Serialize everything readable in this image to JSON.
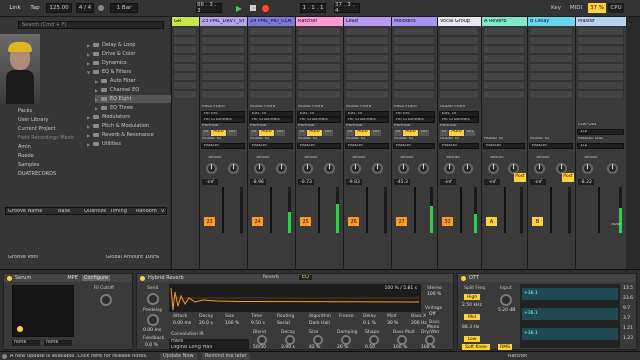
{
  "colors": {
    "accent": "#ff9a1f",
    "meter": "#30d048",
    "yellow": "#ffd23a"
  },
  "topbar": {
    "link": "Link",
    "tap": "Tap",
    "tempo": "125.00",
    "meter_sig": "4 / 4",
    "metro": "1 Bar",
    "position": "1 . 1 . 1",
    "loop_start": "86 . 3 . 3",
    "loop_len": "37 . 3 . 4",
    "key": "Key",
    "midi": "MIDI",
    "cpu_pct": "37 %",
    "cpu": "CPU"
  },
  "browser": {
    "search_placeholder": "Search (Cmd + F)",
    "places": [
      "Packs",
      "User Library",
      "Current Project",
      "Field Recordings Mastr",
      "Amin",
      "Ruede",
      "Samples",
      "DUATRECORDS",
      "Groove Pool"
    ],
    "tree": [
      "Delay & Loop",
      "Drive & Color",
      "Dynamics",
      "EQ & Filters",
      "Auto Filter",
      "Channel EQ",
      "EQ Eight",
      "EQ Three",
      "Modulators",
      "Pitch & Modulation",
      "Reverb & Resonance",
      "Utilities"
    ],
    "groove_cols": [
      "Groove Name",
      "Base",
      "Quantize",
      "Timing",
      "Random",
      "V"
    ],
    "global_amount_label": "Global Amount",
    "global_amount": "100%"
  },
  "tracks": [
    {
      "name": "GR",
      "color": "#c8e64a",
      "num": "",
      "vol": ""
    },
    {
      "name": "23 PML_DRV7_SY",
      "color": "#b6a4e6",
      "num": "23",
      "vol": "-inf"
    },
    {
      "name": "24 PML_MD_CLA",
      "color": "#7b78dc",
      "num": "24",
      "vol": "-8.96"
    },
    {
      "name": "Ratchet",
      "color": "#ff9ad4",
      "num": "25",
      "vol": "-0.73"
    },
    {
      "name": "Lead",
      "color": "#b89af0",
      "num": "26",
      "vol": "-9.83"
    },
    {
      "name": "Melodics",
      "color": "#a993f0",
      "num": "27",
      "vol": "-45.3"
    },
    {
      "name": "Vocal Group",
      "color": "#e7e7f3",
      "num": "32",
      "vol": "-inf"
    },
    {
      "name": "A Reverb",
      "color": "#7ee8c8",
      "num": "A",
      "vol": "-inf"
    },
    {
      "name": "B Delay",
      "color": "#67d7ee",
      "num": "B",
      "vol": "-inf"
    },
    {
      "name": "Master",
      "color": "#b9d3ee",
      "num": "",
      "vol": "-8.22"
    }
  ],
  "io": {
    "midi_from": "MIDI From",
    "audio_from": "Audio From",
    "all_ins": "All Ins",
    "ext_in": "Ext. In",
    "all_channels": "All Channels",
    "monitor": "Monitor",
    "in": "In",
    "auto": "Auto",
    "off": "Off",
    "audio_to": "Audio To",
    "master": "Master",
    "sends": "Sends",
    "cue_out": "Cue Out",
    "cue_val": "1/2",
    "master_out": "Master Out",
    "master_val": "1/2",
    "post": "Post",
    "solo": "Solo"
  },
  "devices": {
    "serum": {
      "title": "Serum",
      "mpe": "MPE",
      "configure": "Configure",
      "fil_cutoff": "Fil Cutoff",
      "none": "none"
    },
    "reverb": {
      "title": "Hybrid Reverb",
      "reverb_tab": "Reverb",
      "eq_tab": "EQ",
      "send": "Send",
      "predelay": "Predelay",
      "predelay_val": "0.00 ms",
      "feedback": "Feedback",
      "feedback_val": "0.0 %",
      "env_labels": [
        "Attack",
        "Decay",
        "Size",
        "Time",
        "Routing",
        "Algorithm",
        "Freeze",
        "Delay",
        "Mod",
        "Bass X"
      ],
      "env_vals": [
        "0.00 ms",
        "20.0 s",
        "100 %",
        "9.50 s",
        "Serial",
        "Dark Hall",
        "",
        "0.1 %",
        "30 %",
        "200 Hz"
      ],
      "pct": "100 % / 5.81 s",
      "convolution": "Convolution IR",
      "halls": "Halls",
      "ir": "Digital Long Hall",
      "bottom": [
        "Blend",
        "Decay",
        "Size",
        "Damping",
        "Shape",
        "Bass Mult",
        "Dry/Wet"
      ],
      "bottom_vals": [
        "50/50",
        "3.90 s",
        "42 %",
        "20 %",
        "0.50",
        "100 %",
        "100 %"
      ],
      "stereo": "Stereo",
      "stereo_val": "100 %",
      "vintage": "Vintage",
      "vint_val": "Off",
      "bass": "Bass",
      "mono": "Mono"
    },
    "ott": {
      "title": "OTT",
      "split": "Split Freq",
      "input": "Input",
      "high": "High",
      "mid": "Mid",
      "low": "Low",
      "high_f": "2.50 kHz",
      "low_f": "88.3 Hz",
      "in_db": "5.20 dB",
      "soft_knee": "Soft Knee",
      "rms": "RMS",
      "gr_vals": [
        "+36.1",
        "+36.1",
        "+36.1"
      ],
      "scale": [
        "13.5",
        "23.6",
        "9.7",
        "3.7",
        "1.21",
        "1.23"
      ]
    }
  },
  "status": {
    "msg": "A new update is available. Click here for release notes.",
    "update": "Update Now",
    "remind": "Remind me later",
    "track_label": "Ratchet"
  }
}
